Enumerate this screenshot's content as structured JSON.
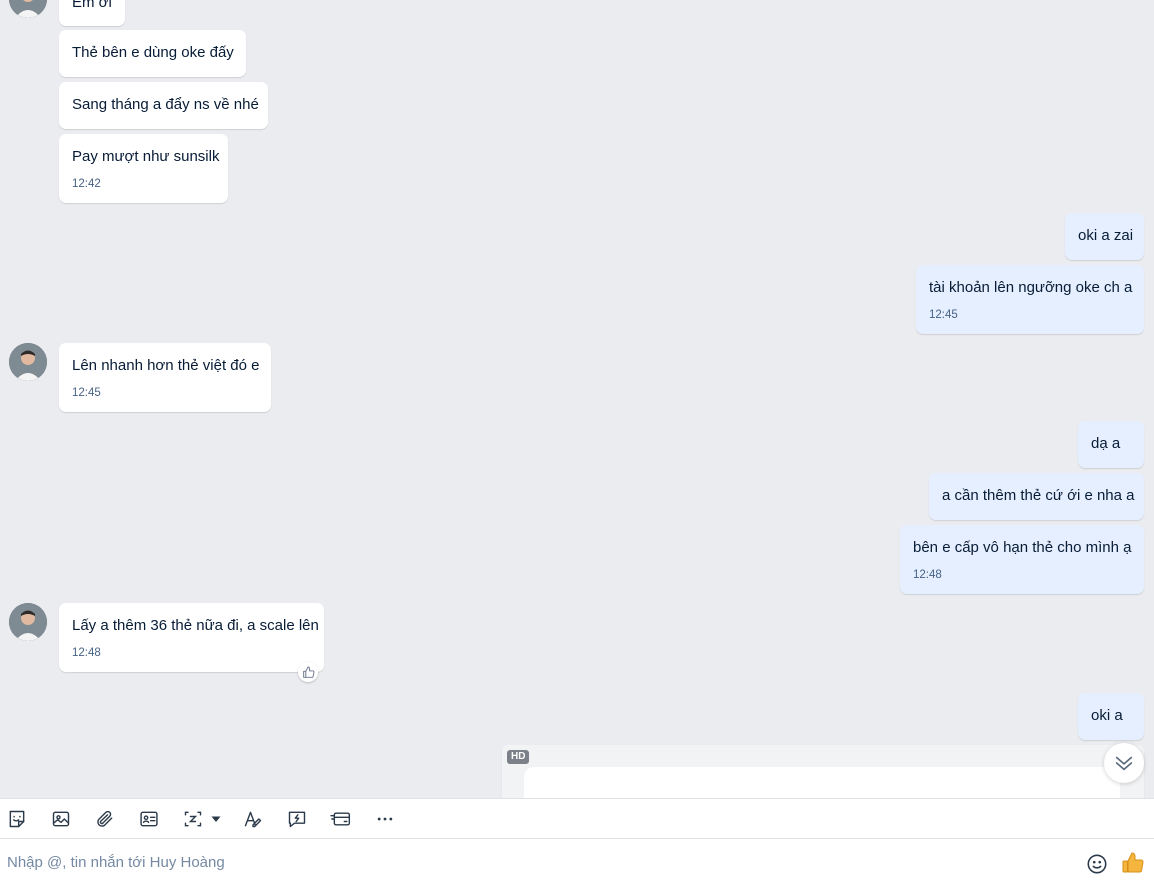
{
  "messages": {
    "m1": {
      "text": "Em ơi"
    },
    "m2": {
      "text": "Thẻ bên e dùng oke đấy"
    },
    "m3": {
      "text": "Sang tháng a đẩy ns về nhé"
    },
    "m4": {
      "text": "Pay mượt như sunsilk",
      "time": "12:42"
    },
    "m5": {
      "text": "oki a zai"
    },
    "m6": {
      "text": "tài khoản lên ngưỡng oke ch a",
      "time": "12:45"
    },
    "m7": {
      "text": "Lên nhanh hơn thẻ việt đó e",
      "time": "12:45"
    },
    "m8": {
      "text": "dạ a"
    },
    "m9": {
      "text": "a cần thêm thẻ cứ ới e nha a"
    },
    "m10": {
      "text": "bên e cấp vô hạn thẻ cho mình ạ",
      "time": "12:48"
    },
    "m11": {
      "text": "Lấy a thêm 36 thẻ nữa đi, a scale lên",
      "time": "12:48"
    },
    "m12": {
      "text": "oki a"
    }
  },
  "media": {
    "badge": "HD"
  },
  "composer": {
    "placeholder": "Nhập @, tin nhắn tới Huy Hoàng"
  },
  "icons": {
    "toolbar": [
      "sticker-icon",
      "image-icon",
      "attachment-icon",
      "contact-card-icon",
      "screenshot-icon",
      "text-format-icon",
      "quick-message-icon",
      "card-icon",
      "more-icon"
    ],
    "composer": [
      "emoji-icon",
      "thumbs-up-icon"
    ]
  },
  "colors": {
    "background": "#ebecf0",
    "incoming_bubble": "#ffffff",
    "outgoing_bubble": "#e5efff",
    "text": "#081c36",
    "time": "#476285"
  }
}
